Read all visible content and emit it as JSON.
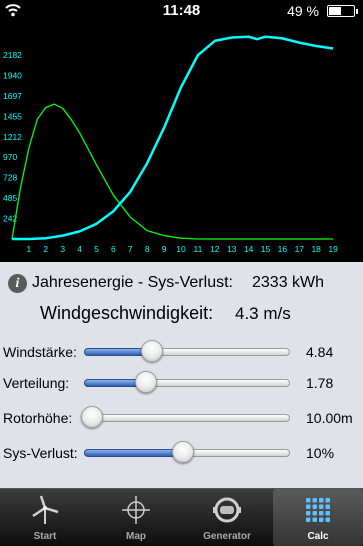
{
  "status_bar": {
    "time": "11:48",
    "battery": "49 %"
  },
  "chart_data": {
    "type": "line",
    "x_ticks": [
      "1",
      "2",
      "3",
      "4",
      "5",
      "6",
      "7",
      "8",
      "9",
      "10",
      "11",
      "12",
      "13",
      "14",
      "15",
      "16",
      "17",
      "18",
      "19"
    ],
    "y_ticks": [
      "242",
      "485",
      "728",
      "970",
      "1212",
      "1455",
      "1697",
      "1940",
      "2182"
    ],
    "series": [
      {
        "x": [
          0,
          0.5,
          1,
          1.5,
          2,
          2.5,
          3,
          3.5,
          4,
          5,
          6,
          7,
          8,
          9,
          10,
          11,
          12,
          13,
          14,
          15,
          16,
          17,
          18,
          19
        ],
        "y": [
          0,
          600,
          1080,
          1420,
          1560,
          1600,
          1550,
          1420,
          1260,
          880,
          520,
          260,
          100,
          40,
          10,
          0,
          0,
          0,
          0,
          0,
          0,
          0,
          0,
          0
        ]
      },
      {
        "x": [
          0,
          1,
          2,
          3,
          4,
          5,
          6,
          7,
          8,
          9,
          10,
          11,
          12,
          13,
          14,
          14.5,
          15,
          15.5,
          16,
          17,
          18,
          19
        ],
        "y": [
          0,
          0,
          10,
          40,
          90,
          180,
          330,
          560,
          900,
          1320,
          1800,
          2180,
          2350,
          2390,
          2400,
          2370,
          2400,
          2390,
          2380,
          2330,
          2290,
          2260
        ]
      }
    ],
    "colors": [
      "#00ff00",
      "#00ffff"
    ],
    "tick_color": "#00ffff",
    "grid": false
  },
  "panel": {
    "jahresenergie_label": "Jahresenergie - Sys-Verlust:",
    "jahresenergie_value": "2333 kWh",
    "windgeschwindigkeit_label": "Windgeschwindigkeit:",
    "windgeschwindigkeit_value": "4.3 m/s",
    "rows": [
      {
        "label": "Windstärke:",
        "value": "4.84",
        "level": 0.33
      },
      {
        "label": "Verteilung:",
        "value": "1.78",
        "level": 0.3
      },
      {
        "label": "Rotorhöhe:",
        "value": "10.00m",
        "level": 0.04
      },
      {
        "label": "Sys-Verlust:",
        "value": "10%",
        "level": 0.48
      }
    ]
  },
  "tabs": [
    {
      "label": "Start",
      "icon": "wind-turbine-icon",
      "active": false
    },
    {
      "label": "Map",
      "icon": "crosshair-icon",
      "active": false
    },
    {
      "label": "Generator",
      "icon": "generator-icon",
      "active": false
    },
    {
      "label": "Calc",
      "icon": "calculator-icon",
      "active": true
    }
  ]
}
